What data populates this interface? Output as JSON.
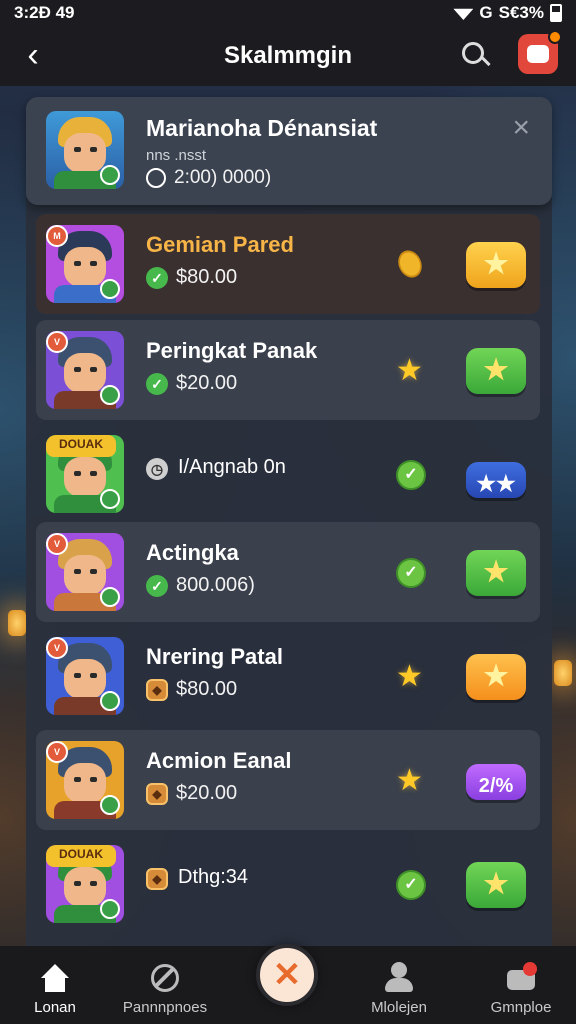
{
  "status_bar": {
    "time": "3:2Ð 49",
    "signal": "G",
    "battery": "S€3%"
  },
  "header": {
    "title": "Skalmmgin",
    "back_icon": "chevron-left-icon",
    "search_icon": "search-icon",
    "profile_icon": "game-bag-icon"
  },
  "featured": {
    "name": "Marianoha Dénansiat",
    "sub": "nns .nsst",
    "amount": "2:00) 0000)",
    "close": "×"
  },
  "list": [
    {
      "name": "Gemian Pared",
      "price": "$80.00",
      "tag": "M",
      "action_label": "★",
      "mid": "coin",
      "name_color": "#f7b548",
      "bg": "#3a3030",
      "btn": "gold",
      "price_icon": "check"
    },
    {
      "name": "Peringkat Panak",
      "price": "$20.00",
      "tag": "V",
      "action_label": "★",
      "mid": "star",
      "name_color": "#ffffff",
      "bg": "#3a404c",
      "btn": "green",
      "price_icon": "check"
    },
    {
      "name": "I/Angnab 0n",
      "price": "",
      "tag": "DOUAK",
      "action_label": "★★",
      "mid": "check",
      "name_color": "#ffffff",
      "bg": "transparent",
      "btn": "blue",
      "price_icon": "clock"
    },
    {
      "name": "Actingka",
      "price": "800.006)",
      "tag": "V",
      "action_label": "★",
      "mid": "check",
      "name_color": "#ffffff",
      "bg": "#3a404c",
      "btn": "green",
      "price_icon": "check"
    },
    {
      "name": "Nrering Patal",
      "price": "$80.00",
      "tag": "V",
      "action_label": "★",
      "mid": "star",
      "name_color": "#ffffff",
      "bg": "transparent",
      "btn": "orange",
      "price_icon": "coin"
    },
    {
      "name": "Acmion Eanal",
      "price": "$20.00",
      "tag": "V",
      "action_label": "2/%",
      "mid": "star",
      "name_color": "#ffffff",
      "bg": "#3a404c",
      "btn": "purple",
      "price_icon": "coin"
    },
    {
      "name": "Dthg:34",
      "price": "",
      "tag": "DOUAK",
      "action_label": "★",
      "mid": "check",
      "name_color": "#ffffff",
      "bg": "transparent",
      "btn": "green",
      "price_icon": "coin"
    }
  ],
  "nav": [
    {
      "label": "Lonan",
      "icon": "home-icon"
    },
    {
      "label": "Pannnpnoes",
      "icon": "compass-icon"
    },
    {
      "label": "",
      "icon": "center-action-icon"
    },
    {
      "label": "Mlolejen",
      "icon": "profile-icon"
    },
    {
      "label": "Gmnploe",
      "icon": "inbox-icon"
    }
  ]
}
